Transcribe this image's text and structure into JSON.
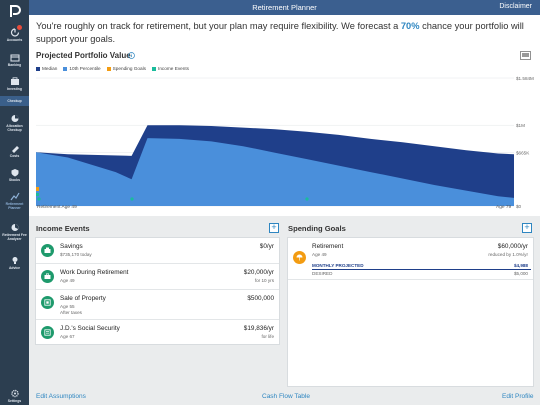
{
  "header": {
    "title": "Retirement Planner",
    "disclaimer": "Disclaimer"
  },
  "sidebar": {
    "items": [
      {
        "label": "Accounts",
        "icon": "accounts-icon"
      },
      {
        "label": "Banking",
        "icon": "banking-icon"
      },
      {
        "label": "Investing",
        "icon": "investing-icon"
      },
      {
        "label": "Checkup",
        "icon": "checkup-icon"
      },
      {
        "label": "Allocation Checkup",
        "icon": "allocation-icon"
      },
      {
        "label": "Costs",
        "icon": "costs-icon"
      },
      {
        "label": "Stocks",
        "icon": "stocks-icon"
      },
      {
        "label": "Retirement Planner",
        "icon": "retirement-icon"
      },
      {
        "label": "Retirement Fee Analyzer",
        "icon": "fee-analyzer-icon"
      },
      {
        "label": "Advice",
        "icon": "advice-icon"
      },
      {
        "label": "Settings",
        "icon": "settings-icon"
      }
    ]
  },
  "headline": {
    "before": "You're roughly on track for retirement, but your plan may require flexibility. We forecast a ",
    "percent": "70%",
    "after": " chance your portfolio will support your goals."
  },
  "chart_section": {
    "title": "Projected Portfolio Value",
    "legend": [
      {
        "label": "Median",
        "color": "#1f3f8a"
      },
      {
        "label": "10th Percentile",
        "color": "#4a8fdb"
      },
      {
        "label": "Spending Goals",
        "color": "#f39c12"
      },
      {
        "label": "Income Events",
        "color": "#1abc9c"
      }
    ]
  },
  "chart_data": {
    "type": "area",
    "x_start_label": "Retirement Age 49",
    "x_end_label": "Age 79",
    "y_ticks": [
      "$1.584M",
      "$1M",
      "$665K",
      "$0"
    ],
    "series": [
      {
        "name": "Median",
        "color": "#1f3f8a",
        "x": [
          49,
          51,
          55,
          56,
          58,
          60,
          62,
          64,
          66,
          68,
          70,
          72,
          74,
          76,
          78,
          79
        ],
        "values": [
          665000,
          640000,
          620000,
          1000000,
          1000000,
          990000,
          970000,
          950000,
          920000,
          880000,
          830000,
          790000,
          740000,
          690000,
          650000,
          640000
        ]
      },
      {
        "name": "10th Percentile",
        "color": "#4a8fdb",
        "x": [
          49,
          51,
          54,
          55,
          56,
          58,
          60,
          62,
          64,
          66,
          68,
          70,
          72,
          74,
          76,
          78,
          79
        ],
        "values": [
          665000,
          600000,
          420000,
          330000,
          840000,
          830000,
          800000,
          740000,
          660000,
          580000,
          500000,
          420000,
          340000,
          260000,
          190000,
          120000,
          100000
        ]
      }
    ],
    "ylim": [
      0,
      1584000
    ],
    "xlim": [
      49,
      79
    ]
  },
  "income_events": {
    "title": "Income Events",
    "items": [
      {
        "name": "Savings",
        "sub": "$735,170 today",
        "sub2": "",
        "amount": "$0/yr",
        "amount_sub": ""
      },
      {
        "name": "Work During Retirement",
        "sub": "Age 49",
        "sub2": "",
        "amount": "$20,000/yr",
        "amount_sub": "for 10 yrs"
      },
      {
        "name": "Sale of Property",
        "sub": "Age 55",
        "sub2": "After taxes",
        "amount": "$500,000",
        "amount_sub": ""
      },
      {
        "name": "J.D.'s Social Security",
        "sub": "Age 67",
        "sub2": "",
        "amount": "$19,836/yr",
        "amount_sub": "for life"
      }
    ]
  },
  "spending_goals": {
    "title": "Spending Goals",
    "items": [
      {
        "name": "Retirement",
        "sub": "Age 49",
        "amount": "$60,000/yr",
        "amount_sub": "reduced by 1.0%/yr",
        "monthly_label": "MONTHLY PROJECTED",
        "monthly_value": "$4,988",
        "desired_label": "DESIRED",
        "desired_value": "$5,000"
      }
    ]
  },
  "footer": {
    "edit_assumptions": "Edit Assumptions",
    "cash_flow_table": "Cash Flow Table",
    "edit_profile": "Edit Profile"
  }
}
